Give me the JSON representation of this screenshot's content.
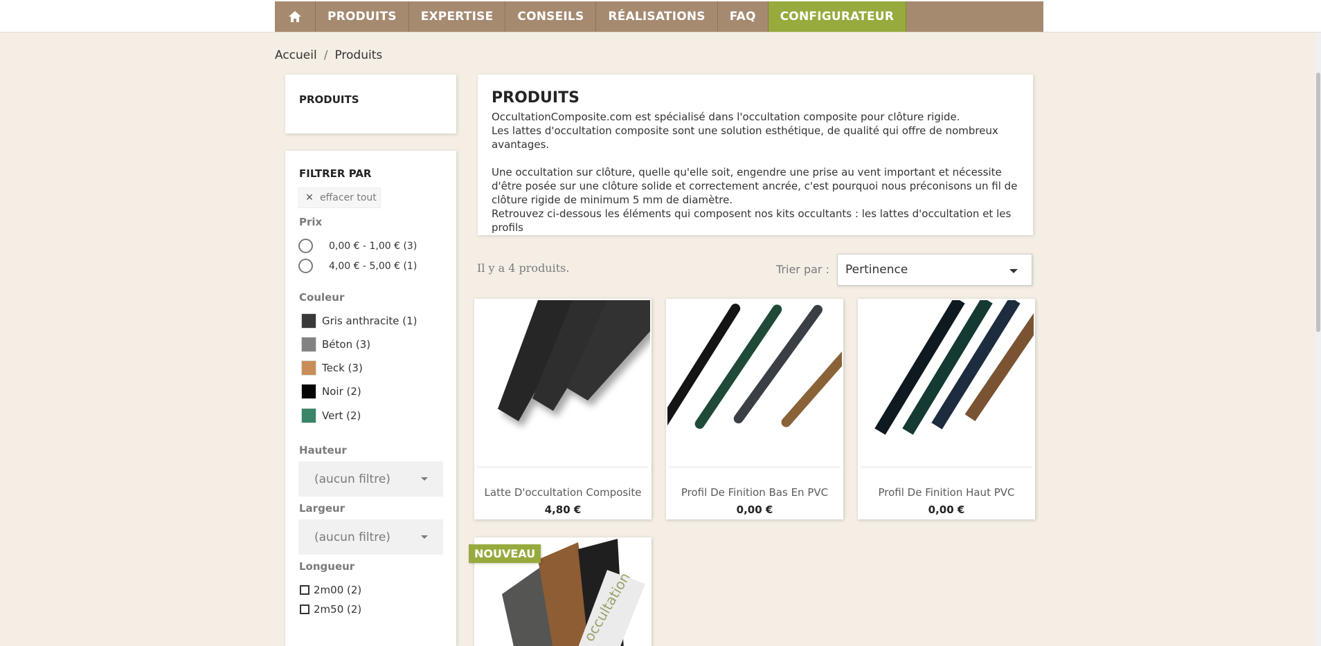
{
  "nav": {
    "home_icon": "home-icon",
    "items": [
      "PRODUITS",
      "EXPERTISE",
      "CONSEILS",
      "RÉALISATIONS",
      "FAQ",
      "CONFIGURATEUR"
    ]
  },
  "colors": {
    "nav_bg": "#a68a70",
    "accent_green": "#97aa3e",
    "page_bg": "#f4eee5"
  },
  "breadcrumb": {
    "home": "Accueil",
    "separator": "/",
    "current": "Produits"
  },
  "sidebar": {
    "title": "PRODUITS"
  },
  "filters": {
    "title": "FILTRER PAR",
    "clear_all": "effacer tout",
    "price": {
      "label": "Prix",
      "options": [
        "0,00 € - 1,00 € (3)",
        "4,00 € - 5,00 € (1)"
      ]
    },
    "color": {
      "label": "Couleur",
      "options": [
        {
          "label": "Gris anthracite (1)",
          "swatch": "#3a3a3a"
        },
        {
          "label": "Béton (3)",
          "swatch": "#828282"
        },
        {
          "label": "Teck (3)",
          "swatch": "#c98e58"
        },
        {
          "label": "Noir (2)",
          "swatch": "#050505"
        },
        {
          "label": "Vert (2)",
          "swatch": "#3a8468"
        }
      ]
    },
    "height": {
      "label": "Hauteur",
      "value": "(aucun filtre)"
    },
    "width": {
      "label": "Largeur",
      "value": "(aucun filtre)"
    },
    "length": {
      "label": "Longueur",
      "options": [
        "2m00 (2)",
        "2m50 (2)"
      ]
    }
  },
  "category": {
    "title": "PRODUITS",
    "paragraphs": [
      "OccultationComposite.com est spécialisé dans l'occultation composite pour clôture rigide.",
      "Les lattes d'occultation composite sont une solution esthétique, de qualité qui offre de nombreux avantages.",
      "",
      "Une occultation sur clôture, quelle qu'elle soit, engendre une prise au vent important et nécessite d'être posée sur une clôture solide et correctement ancrée, c'est pourquoi nous préconisons un fil de clôture rigide de minimum 5 mm de diamètre.",
      "Retrouvez ci-dessous les éléments qui composent nos kits occultants : les lattes d'occultation et les profils"
    ]
  },
  "listing": {
    "count_text": "Il y a 4 produits.",
    "sort_label": "Trier par :",
    "sort_value": "Pertinence"
  },
  "products": [
    {
      "name": "Latte D'occultation Composite",
      "price": "4,80 €"
    },
    {
      "name": "Profil De Finition Bas En PVC",
      "price": "0,00 €"
    },
    {
      "name": "Profil De Finition Haut PVC",
      "price": "0,00 €"
    }
  ],
  "new_badge": "NOUVEAU"
}
